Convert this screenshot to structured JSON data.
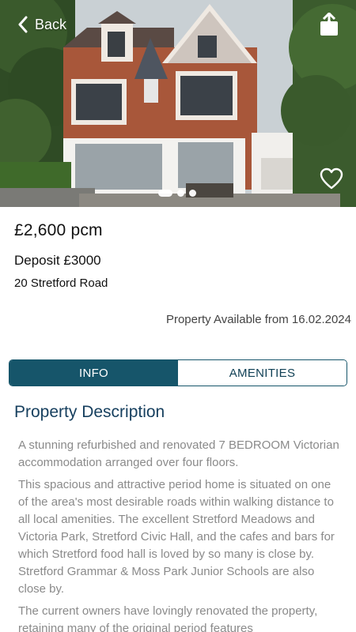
{
  "nav": {
    "back_label": "Back",
    "back_icon": "chevron-left-icon",
    "share_icon": "share-icon",
    "favorite_icon": "heart-outline-icon"
  },
  "gallery": {
    "image_count": 3,
    "active_index": 0
  },
  "listing": {
    "price": "£2,600 pcm",
    "deposit": "Deposit £3000",
    "address": "20 Stretford Road",
    "availability": "Property Available from 16.02.2024"
  },
  "tabs": [
    {
      "label": "INFO",
      "active": true
    },
    {
      "label": "AMENITIES",
      "active": false
    }
  ],
  "description": {
    "title": "Property Description",
    "paragraphs": [
      "A stunning refurbished and renovated 7 BEDROOM Victorian accommodation arranged over four floors.",
      "This spacious and attractive period home is situated on one of the area's most desirable roads within walking distance to all local amenities. The excellent Stretford Meadows and Victoria Park, Stretford Civic Hall, and the cafes and bars for which Stretford food hall is loved by so many is close by. Stretford Grammar & Moss Park Junior Schools are also close by.",
      "The current owners have lovingly renovated the property, retaining many of the original period features"
    ]
  },
  "colors": {
    "accent": "#16556a",
    "title": "#163f5e",
    "body_text": "#8a8a8a"
  }
}
